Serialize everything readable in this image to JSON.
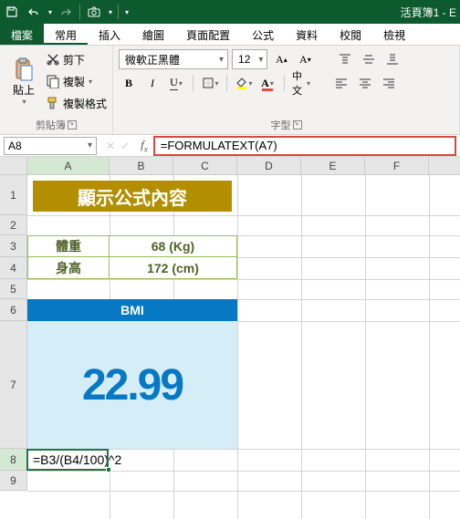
{
  "titlebar": {
    "title": "活頁簿1 - E"
  },
  "tabs": {
    "file": "檔案",
    "home": "常用",
    "insert": "插入",
    "draw": "繪圖",
    "layout": "頁面配置",
    "formulas": "公式",
    "data": "資料",
    "review": "校閱",
    "view": "檢視"
  },
  "clipboard": {
    "paste": "貼上",
    "cut": "剪下",
    "copy": "複製",
    "format_painter": "複製格式",
    "group": "剪貼簿"
  },
  "font": {
    "name": "微軟正黑體",
    "size": "12",
    "group": "字型",
    "ruby": "中文",
    "bold": "B",
    "italic": "I",
    "underline": "U"
  },
  "namebox": "A8",
  "formula": "=FORMULATEXT(A7)",
  "cols": [
    "A",
    "B",
    "C",
    "D",
    "E",
    "F"
  ],
  "rows": [
    "1",
    "2",
    "3",
    "4",
    "5",
    "6",
    "7",
    "8",
    "9"
  ],
  "sheet": {
    "banner": "顯示公式內容",
    "weight_label": "體重",
    "weight_val": "68 (Kg)",
    "height_label": "身高",
    "height_val": "172 (cm)",
    "bmi_label": "BMI",
    "bmi_val": "22.99",
    "a8": "=B3/(B4/100)^2"
  }
}
